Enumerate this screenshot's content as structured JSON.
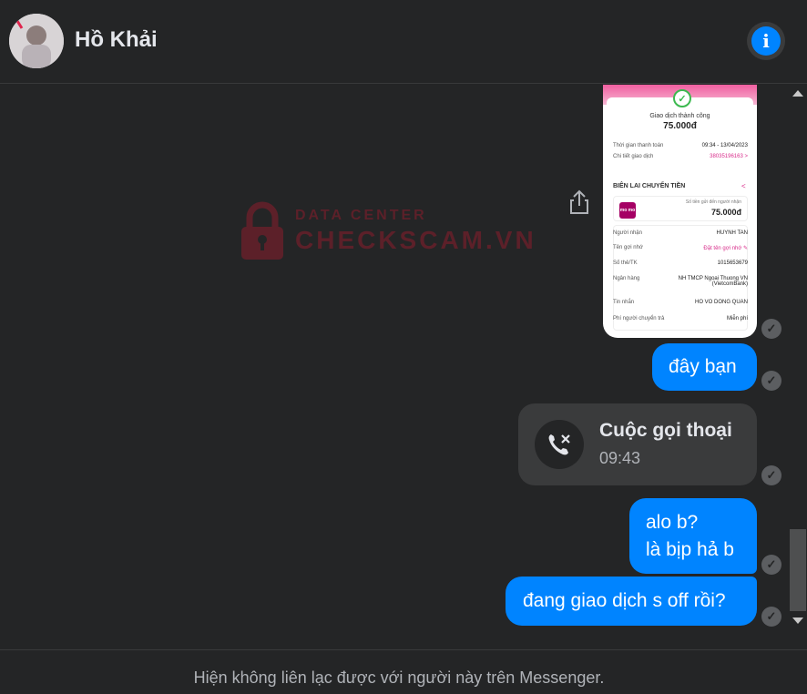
{
  "header": {
    "contact_name": "Hồ Khải",
    "avatar": "contact-avatar",
    "info_icon": "info-icon",
    "info_glyph": "i"
  },
  "watermark": {
    "small": "DATA CENTER",
    "big": "CHECKSCAM.VN",
    "icon": "lock-icon"
  },
  "receipt": {
    "status": "Giao dịch thành công",
    "amount": "75.000đ",
    "rows_top": [
      {
        "label": "Thời gian thanh toán",
        "value": "09:34 - 13/04/2023"
      },
      {
        "label": "Chi tiết giao dịch",
        "value": "38035196163 >"
      }
    ],
    "section_title": "BIÊN LAI CHUYỂN TIỀN",
    "momo_logo": "mo mo",
    "box_label": "Số tiền gửi đến người nhận",
    "box_amount": "75.000đ",
    "rows_bottom": [
      {
        "label": "Người nhận",
        "value": "HUYNH TAN"
      },
      {
        "label": "Tên gợi nhớ",
        "value": "Đặt tên gợi nhớ ✎"
      },
      {
        "label": "Số thẻ/TK",
        "value": "1015653679"
      },
      {
        "label": "Ngân hàng",
        "value": "NH TMCP Ngoai Thuong VN (VietcomBank)"
      },
      {
        "label": "Tin nhắn",
        "value": "HO VO DONG QUAN"
      },
      {
        "label": "Phí người chuyển trả",
        "value": "Miễn phí"
      }
    ]
  },
  "messages": [
    {
      "text": "đây bạn"
    },
    {
      "lines": [
        "alo b?",
        "là bịp hả b"
      ]
    },
    {
      "text": "đang giao dịch s off rồi?"
    }
  ],
  "call": {
    "title": "Cuộc gọi thoại",
    "time": "09:43",
    "icon": "missed-call-icon"
  },
  "status_glyph": "✓",
  "footer": {
    "text": "Hiện không liên lạc được với người này trên Messenger."
  },
  "colors": {
    "background": "#242526",
    "bubble": "#0084ff",
    "call_bubble": "#3a3b3c",
    "info_accent": "#0084ff"
  }
}
